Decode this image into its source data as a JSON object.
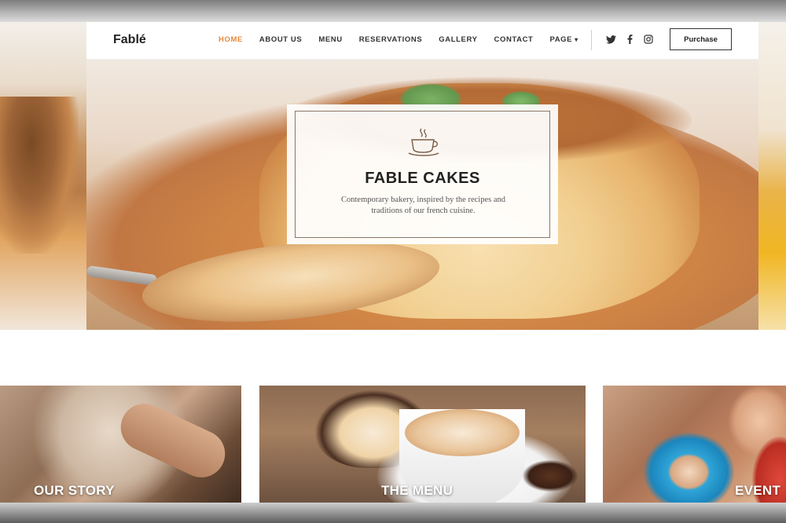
{
  "header": {
    "brand": "Fablé",
    "nav": [
      {
        "label": "HOME",
        "active": true
      },
      {
        "label": "ABOUT US",
        "active": false
      },
      {
        "label": "MENU",
        "active": false
      },
      {
        "label": "RESERVATIONS",
        "active": false
      },
      {
        "label": "GALLERY",
        "active": false
      },
      {
        "label": "CONTACT",
        "active": false
      },
      {
        "label": "PAGE",
        "active": false
      }
    ],
    "socials": [
      "twitter-icon",
      "facebook-icon",
      "instagram-icon"
    ],
    "purchase_label": "Purchase"
  },
  "hero": {
    "title": "FABLE CAKES",
    "subtitle": "Contemporary bakery, inspired by the recipes and traditions of our french cuisine.",
    "icon": "coffee-cup-icon"
  },
  "cards": [
    {
      "label": "OUR STORY"
    },
    {
      "label": "THE MENU"
    },
    {
      "label": "EVENT"
    }
  ],
  "colors": {
    "accent": "#e8893b",
    "text": "#222222",
    "card_border": "#8a7766"
  }
}
